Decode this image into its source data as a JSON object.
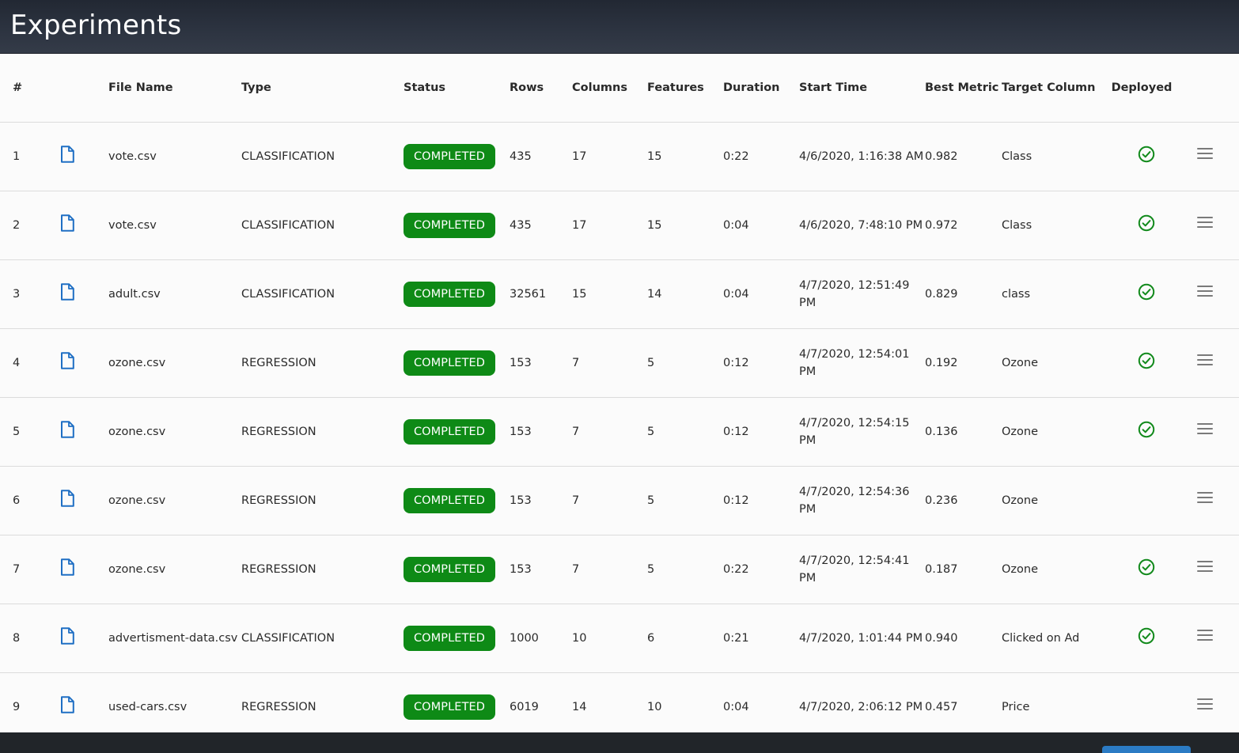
{
  "page": {
    "title": "Experiments"
  },
  "table": {
    "headers": {
      "num": "#",
      "file_name": "File Name",
      "type": "Type",
      "status": "Status",
      "rows": "Rows",
      "columns": "Columns",
      "features": "Features",
      "duration": "Duration",
      "start_time": "Start Time",
      "best_metric": "Best Metric",
      "target_column": "Target Column",
      "deployed": "Deployed"
    },
    "rows": [
      {
        "num": "1",
        "file": "vote.csv",
        "type": "CLASSIFICATION",
        "status": "COMPLETED",
        "rows": "435",
        "columns": "17",
        "features": "15",
        "duration": "0:22",
        "start": "4/6/2020, 1:16:38 AM",
        "metric": "0.982",
        "target": "Class",
        "deployed": true
      },
      {
        "num": "2",
        "file": "vote.csv",
        "type": "CLASSIFICATION",
        "status": "COMPLETED",
        "rows": "435",
        "columns": "17",
        "features": "15",
        "duration": "0:04",
        "start": "4/6/2020, 7:48:10 PM",
        "metric": "0.972",
        "target": "Class",
        "deployed": true
      },
      {
        "num": "3",
        "file": "adult.csv",
        "type": "CLASSIFICATION",
        "status": "COMPLETED",
        "rows": "32561",
        "columns": "15",
        "features": "14",
        "duration": "0:04",
        "start": "4/7/2020, 12:51:49 PM",
        "metric": "0.829",
        "target": "class",
        "deployed": true
      },
      {
        "num": "4",
        "file": "ozone.csv",
        "type": "REGRESSION",
        "status": "COMPLETED",
        "rows": "153",
        "columns": "7",
        "features": "5",
        "duration": "0:12",
        "start": "4/7/2020, 12:54:01 PM",
        "metric": "0.192",
        "target": "Ozone",
        "deployed": true
      },
      {
        "num": "5",
        "file": "ozone.csv",
        "type": "REGRESSION",
        "status": "COMPLETED",
        "rows": "153",
        "columns": "7",
        "features": "5",
        "duration": "0:12",
        "start": "4/7/2020, 12:54:15 PM",
        "metric": "0.136",
        "target": "Ozone",
        "deployed": true
      },
      {
        "num": "6",
        "file": "ozone.csv",
        "type": "REGRESSION",
        "status": "COMPLETED",
        "rows": "153",
        "columns": "7",
        "features": "5",
        "duration": "0:12",
        "start": "4/7/2020, 12:54:36 PM",
        "metric": "0.236",
        "target": "Ozone",
        "deployed": false
      },
      {
        "num": "7",
        "file": "ozone.csv",
        "type": "REGRESSION",
        "status": "COMPLETED",
        "rows": "153",
        "columns": "7",
        "features": "5",
        "duration": "0:22",
        "start": "4/7/2020, 12:54:41 PM",
        "metric": "0.187",
        "target": "Ozone",
        "deployed": true
      },
      {
        "num": "8",
        "file": "advertisment-data.csv",
        "type": "CLASSIFICATION",
        "status": "COMPLETED",
        "rows": "1000",
        "columns": "10",
        "features": "6",
        "duration": "0:21",
        "start": "4/7/2020, 1:01:44 PM",
        "metric": "0.940",
        "target": "Clicked on Ad",
        "deployed": true
      },
      {
        "num": "9",
        "file": "used-cars.csv",
        "type": "REGRESSION",
        "status": "COMPLETED",
        "rows": "6019",
        "columns": "14",
        "features": "10",
        "duration": "0:04",
        "start": "4/7/2020, 2:06:12 PM",
        "metric": "0.457",
        "target": "Price",
        "deployed": false
      }
    ]
  },
  "icons": {
    "file": "file-icon",
    "deployed": "check-circle-icon",
    "row_menu": "hamburger-menu-icon"
  },
  "colors": {
    "status_completed": "#0e8a16",
    "file_icon": "#1f6fc4",
    "check_icon": "#128a1c",
    "header_bg": "#2c3340"
  }
}
